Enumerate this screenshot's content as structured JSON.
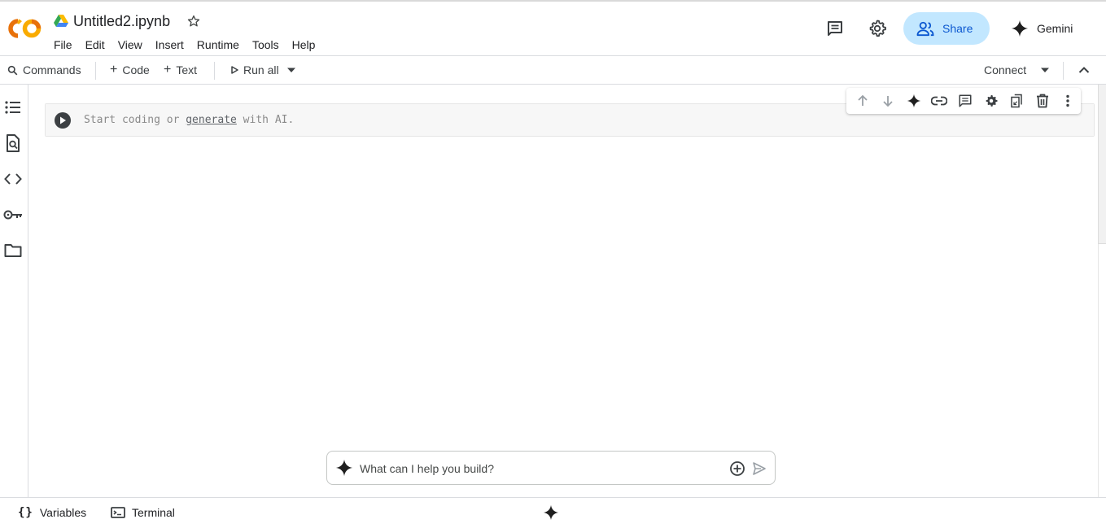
{
  "app": {
    "logo_icon": "colab-logo",
    "notebook_title": "Untitled2.ipynb",
    "colors": {
      "accent": "#0b57d0",
      "share_bg": "#c2e7ff",
      "logo_orange": "#f9ab00",
      "logo_dark_orange": "#e8710a"
    }
  },
  "menu": {
    "items": [
      "File",
      "Edit",
      "View",
      "Insert",
      "Runtime",
      "Tools",
      "Help"
    ]
  },
  "header_right": {
    "comments_icon": "comment-icon",
    "settings_icon": "gear-icon",
    "share_label": "Share",
    "gemini_label": "Gemini"
  },
  "toolbar": {
    "commands_label": "Commands",
    "code_label": "Code",
    "text_label": "Text",
    "run_all_label": "Run all",
    "connect_label": "Connect"
  },
  "sidebar": {
    "items": [
      "table-of-contents-icon",
      "find-replace-icon",
      "code-snippets-icon",
      "secrets-key-icon",
      "files-folder-icon"
    ]
  },
  "cell": {
    "placeholder_before": "Start coding or ",
    "placeholder_link": "generate",
    "placeholder_after": " with AI."
  },
  "cell_toolbar": {
    "items": [
      "move-up-icon",
      "move-down-icon",
      "gemini-sparkle-icon",
      "link-icon",
      "comment-icon",
      "gear-icon",
      "mirror-cell-icon",
      "delete-icon",
      "more-vert-icon"
    ]
  },
  "prompt": {
    "placeholder": "What can I help you build?"
  },
  "statusbar": {
    "variables_label": "Variables",
    "terminal_label": "Terminal"
  }
}
